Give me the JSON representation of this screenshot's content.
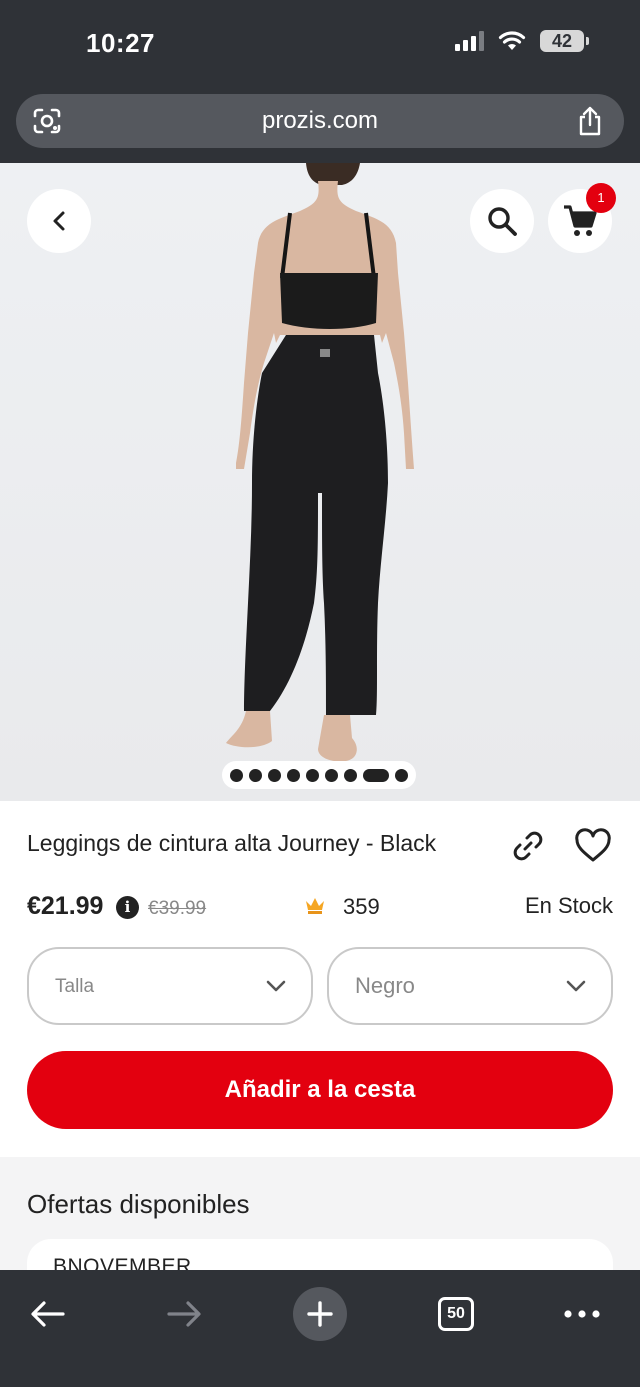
{
  "status_bar": {
    "time": "10:27",
    "battery": "42"
  },
  "browser": {
    "url": "prozis.com",
    "tab_count": "50"
  },
  "header": {
    "cart_count": "1"
  },
  "gallery": {
    "image_count": 9,
    "active_index": 7
  },
  "product": {
    "title": "Leggings de cintura alta Journey - Black",
    "price": "€21.99",
    "old_price": "€39.99",
    "points": "359",
    "stock": "En Stock"
  },
  "options": {
    "size_placeholder": "Talla",
    "color_value": "Negro"
  },
  "add_to_cart_label": "Añadir a la cesta",
  "offers": {
    "title": "Ofertas disponibles",
    "first_code": "BNOVEMBER"
  },
  "colors": {
    "accent": "#e3000f",
    "chrome": "#2f3237",
    "crown": "#f5a623"
  }
}
